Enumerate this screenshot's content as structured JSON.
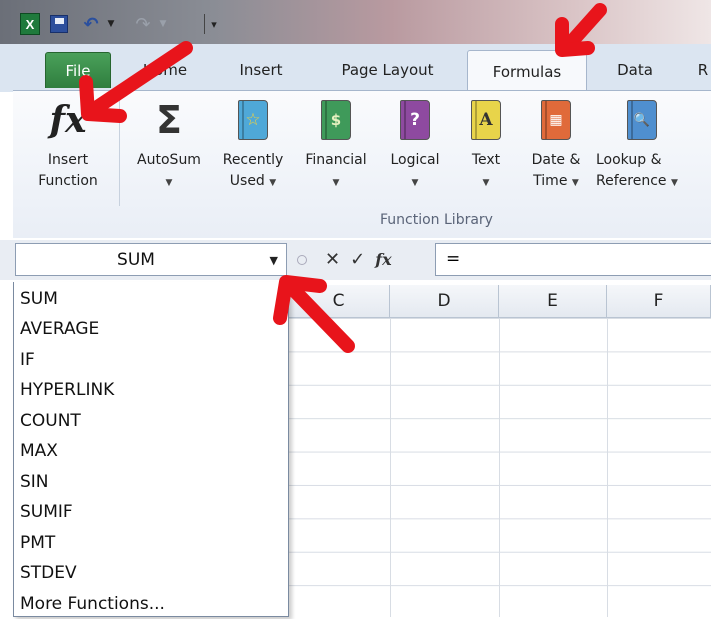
{
  "quick_access": {
    "excel_icon_letter": "X"
  },
  "tabs": {
    "file": "File",
    "home": "Home",
    "insert": "Insert",
    "page_layout": "Page Layout",
    "formulas": "Formulas",
    "data": "Data",
    "review": "R"
  },
  "ribbon": {
    "insert_function": {
      "line1": "Insert",
      "line2": "Function",
      "glyph": "fx"
    },
    "autosum": {
      "line1": "AutoSum",
      "glyph": "Σ"
    },
    "recently_used": {
      "line1": "Recently",
      "line2": "Used",
      "glyph": "☆"
    },
    "financial": {
      "line1": "Financial",
      "glyph": "$"
    },
    "logical": {
      "line1": "Logical",
      "glyph": "?"
    },
    "text": {
      "line1": "Text",
      "glyph": "A"
    },
    "date_time": {
      "line1": "Date &",
      "line2": "Time",
      "glyph": "▦"
    },
    "lookup": {
      "line1": "Lookup &",
      "line2": "Reference",
      "glyph": "🔍"
    },
    "group_label": "Function Library",
    "colors": {
      "recently": "#4fa8d8",
      "financial": "#3f9a5a",
      "logical": "#8e4aa0",
      "text": "#e8d44a",
      "date": "#e06a3a",
      "lookup": "#4f8fcf"
    }
  },
  "formula_bar": {
    "name_box": "SUM",
    "cancel": "✕",
    "enter": "✓",
    "fx": "fx",
    "content": "="
  },
  "columns": [
    "C",
    "D",
    "E",
    "F"
  ],
  "function_list": [
    "SUM",
    "AVERAGE",
    "IF",
    "HYPERLINK",
    "COUNT",
    "MAX",
    "SIN",
    "SUMIF",
    "PMT",
    "STDEV",
    "More Functions..."
  ],
  "annotation_color": "#e8141b"
}
